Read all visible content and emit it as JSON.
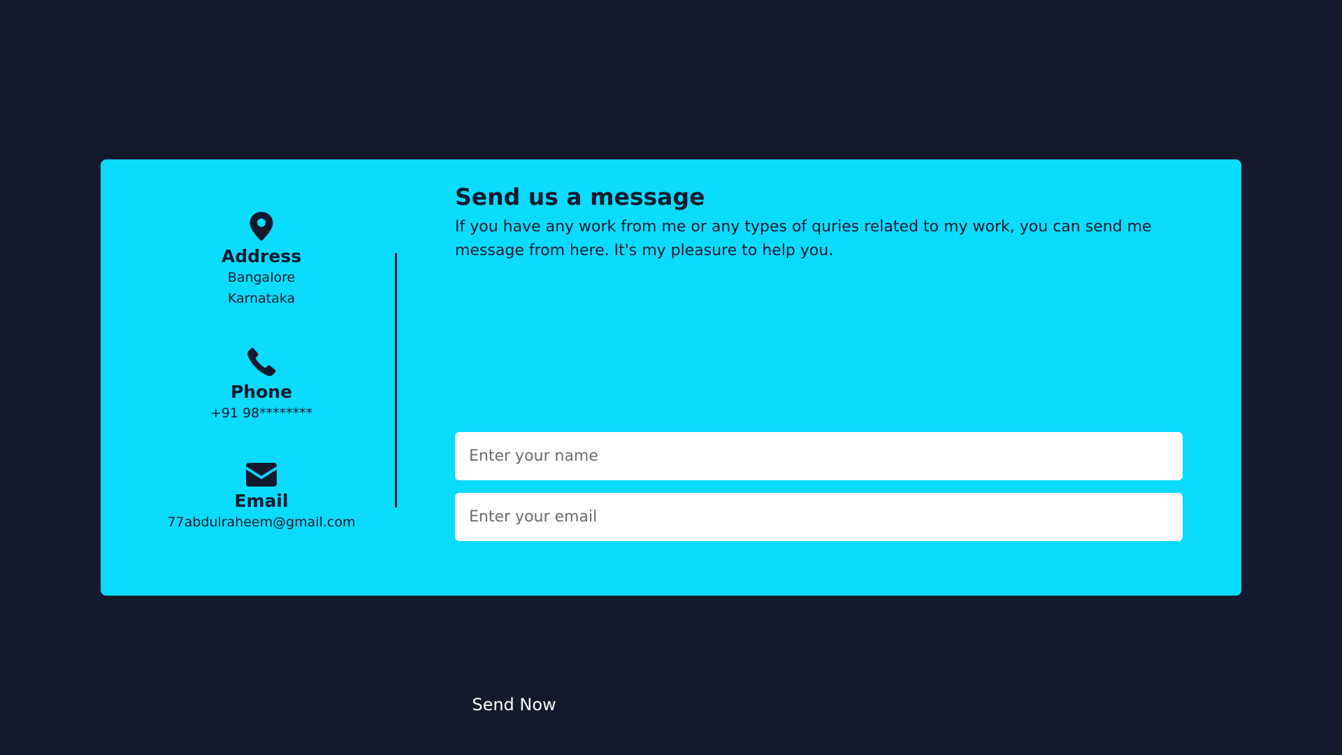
{
  "contact": {
    "address": {
      "icon": "map-pin-icon",
      "title": "Address",
      "line1": "Bangalore",
      "line2": "Karnataka"
    },
    "phone": {
      "icon": "phone-icon",
      "title": "Phone",
      "value": "+91 98********"
    },
    "email": {
      "icon": "envelope-icon",
      "title": "Email",
      "value": "77abdulraheem@gmail.com"
    }
  },
  "form": {
    "title": "Send us a message",
    "description": "If you have any work from me or any types of quries related to my work, you can send me message from here. It's my pleasure to help you.",
    "name_placeholder": "Enter your name",
    "email_placeholder": "Enter your email",
    "submit_label": "Send Now"
  },
  "colors": {
    "background": "#131a2e",
    "card": "#0bdbff",
    "accent_dark": "#131a2e",
    "input_bg": "#ffffff"
  }
}
